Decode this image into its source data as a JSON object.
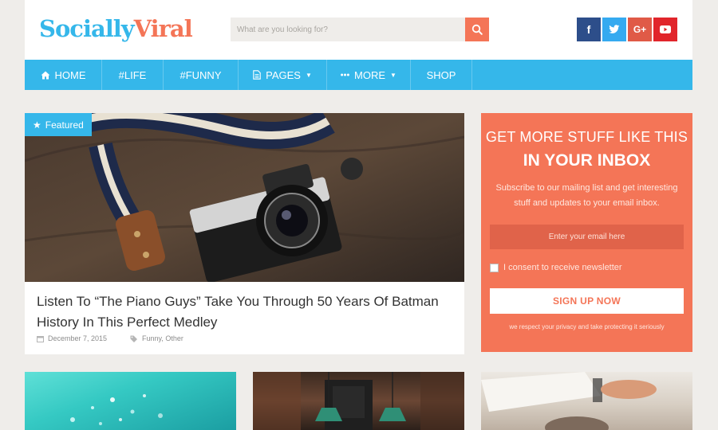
{
  "logo": {
    "part1": "Socially",
    "part2": "Viral"
  },
  "search": {
    "placeholder": "What are you looking for?"
  },
  "socials": [
    {
      "name": "facebook",
      "glyph": "f"
    },
    {
      "name": "twitter",
      "glyph": "t"
    },
    {
      "name": "google-plus",
      "glyph": "G+"
    },
    {
      "name": "youtube",
      "glyph": "▶"
    }
  ],
  "nav": {
    "items": [
      {
        "label": "HOME",
        "icon": "home-icon"
      },
      {
        "label": "#LIFE"
      },
      {
        "label": "#FUNNY"
      },
      {
        "label": "PAGES",
        "icon": "document-icon",
        "caret": "▼"
      },
      {
        "label": "MORE",
        "icon": "dots-icon",
        "caret": "▼"
      },
      {
        "label": "SHOP"
      }
    ]
  },
  "featured": {
    "badge": "Featured",
    "title": "Listen To “The Piano Guys” Take You Through 50 Years Of Batman History In This Perfect Medley",
    "date": "December 7, 2015",
    "categories": "Funny, Other"
  },
  "newsletter": {
    "heading1": "GET MORE STUFF LIKE THIS",
    "heading2": "IN YOUR INBOX",
    "text": "Subscribe to our mailing list and get interesting stuff and updates to your email inbox.",
    "email_placeholder": "Enter your email here",
    "consent": "I consent to receive newsletter",
    "button": "SIGN UP NOW",
    "privacy": "we respect your privacy and take protecting it seriously"
  },
  "colors": {
    "accent_blue": "#35b7ea",
    "accent_orange": "#f47557",
    "background": "#efedea"
  }
}
